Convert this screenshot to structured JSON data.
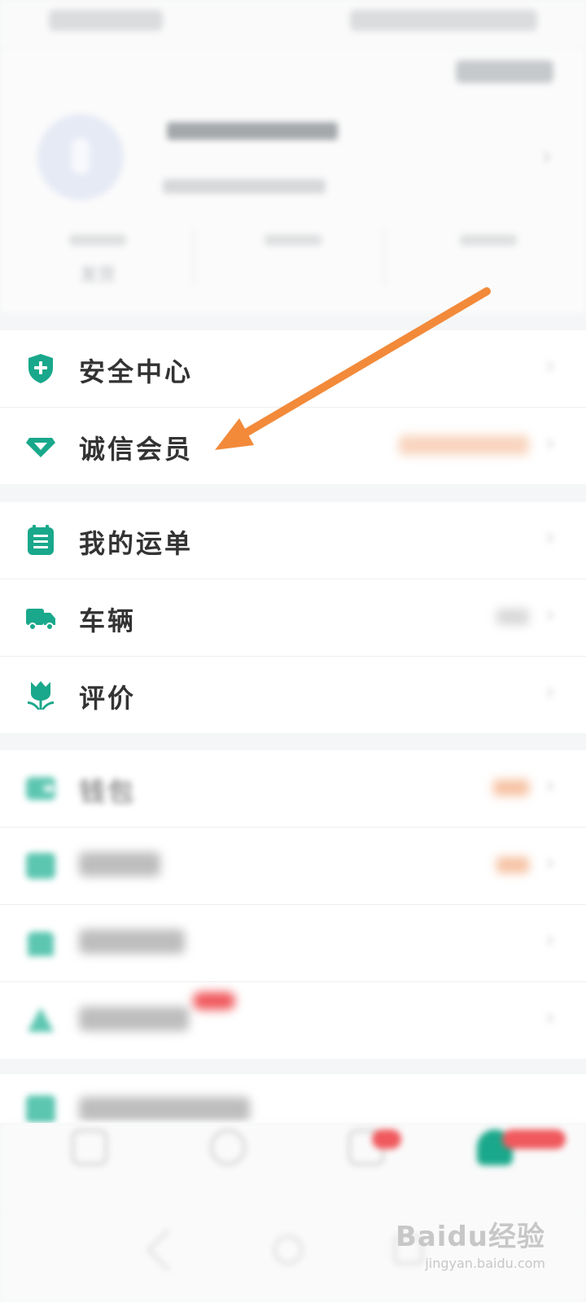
{
  "colors": {
    "brand": "#19a88b",
    "arrow": "#f28a3a",
    "orange_note": "#f19a6c",
    "badge_red": "#f0595d"
  },
  "header": {
    "stats": [
      {
        "value": "发货"
      },
      {
        "value": ""
      },
      {
        "value": ""
      }
    ]
  },
  "group1": {
    "items": [
      {
        "label": "安全中心",
        "icon": "shield-plus-icon"
      },
      {
        "label": "诚信会员",
        "icon": "diamond-icon"
      }
    ]
  },
  "group2": {
    "items": [
      {
        "label": "我的运单",
        "icon": "clipboard-list-icon"
      },
      {
        "label": "车辆",
        "icon": "truck-icon"
      },
      {
        "label": "评价",
        "icon": "tulip-icon"
      }
    ]
  },
  "group3": {
    "items": [
      {
        "label": "钱包",
        "icon": "wallet-icon"
      },
      {
        "label": "",
        "icon": "coupon-icon"
      },
      {
        "label": "",
        "icon": "store-icon"
      },
      {
        "label": "",
        "icon": "share-icon"
      }
    ]
  },
  "group4": {
    "items": [
      {
        "label": "",
        "icon": "app-icon"
      }
    ]
  },
  "tabbar": {
    "active_index": 3,
    "tabs": [
      {
        "icon": "home-icon"
      },
      {
        "icon": "find-icon"
      },
      {
        "icon": "message-icon"
      },
      {
        "icon": "profile-icon"
      }
    ]
  },
  "watermark": {
    "logo": "Baidu经验",
    "url": "jingyan.baidu.com"
  }
}
